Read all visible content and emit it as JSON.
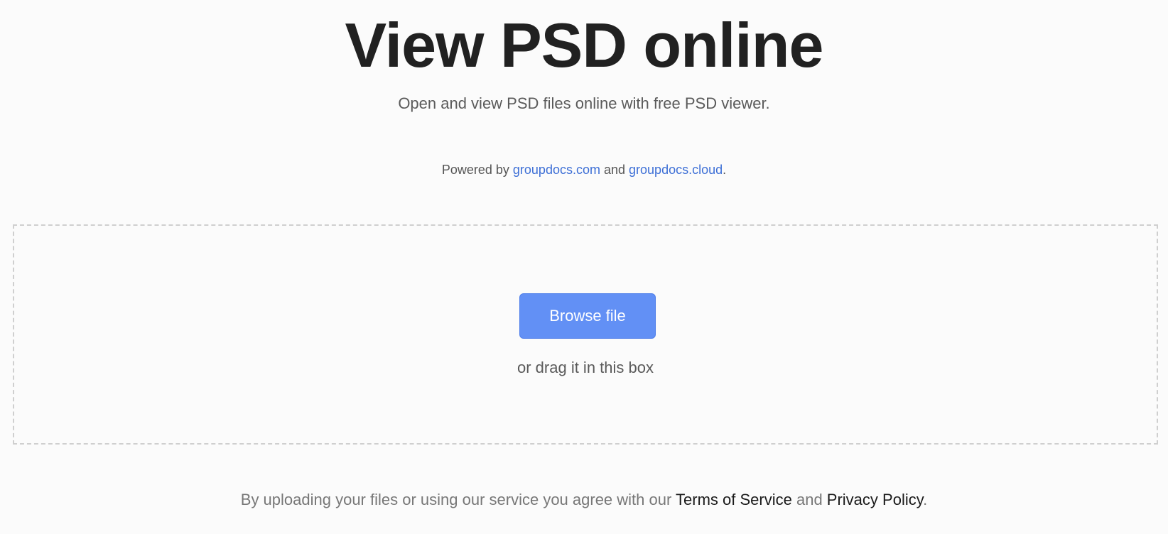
{
  "header": {
    "title": "View PSD online",
    "subtitle": "Open and view PSD files online with free PSD viewer."
  },
  "powered_by": {
    "prefix": "Powered by ",
    "link1": "groupdocs.com",
    "connector": " and ",
    "link2": "groupdocs.cloud",
    "suffix": "."
  },
  "upload": {
    "browse_label": "Browse file",
    "drag_hint": "or drag it in this box"
  },
  "legal": {
    "prefix": "By uploading your files or using our service you agree with our ",
    "terms": "Terms of Service",
    "connector": " and ",
    "privacy": "Privacy Policy",
    "suffix": "."
  },
  "colors": {
    "accent": "#6290f5",
    "link": "#3d6fd6",
    "background": "#fbfbfb",
    "title": "#212121"
  }
}
